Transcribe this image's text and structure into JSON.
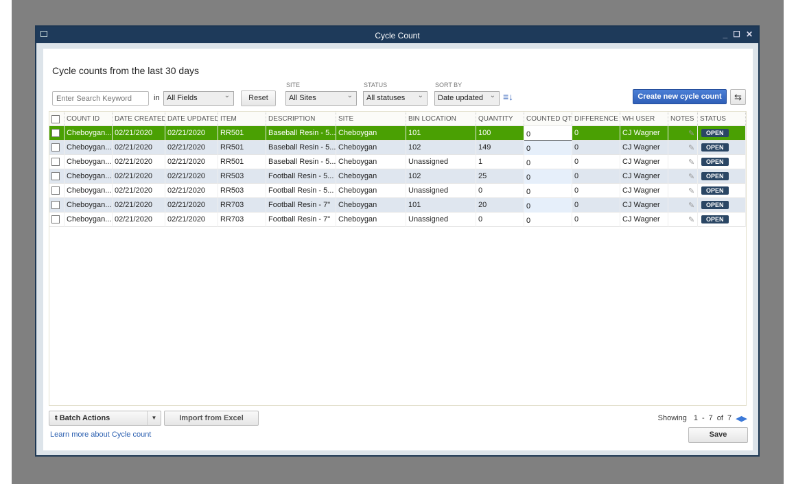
{
  "window": {
    "title": "Cycle Count"
  },
  "header": {
    "title": "Cycle counts from the last 30 days"
  },
  "filters": {
    "search_placeholder": "Enter Search Keyword",
    "in_label": "in",
    "field": "All Fields",
    "reset": "Reset",
    "site_label": "SITE",
    "site": "All Sites",
    "status_label": "STATUS",
    "status": "All statuses",
    "sort_label": "SORT BY",
    "sort": "Date updated",
    "create": "Create new cycle count"
  },
  "table": {
    "columns": [
      "COUNT ID",
      "DATE CREATED",
      "DATE UPDATED",
      "ITEM",
      "DESCRIPTION",
      "SITE",
      "BIN LOCATION",
      "QUANTITY",
      "COUNTED QTY",
      "DIFFERENCE",
      "WH USER",
      "NOTES",
      "STATUS"
    ],
    "rows": [
      [
        "Cheboygan...",
        "02/21/2020",
        "02/21/2020",
        "RR501",
        "Baseball Resin - 5...",
        "Cheboygan",
        "101",
        "100",
        "0",
        "0",
        "CJ Wagner",
        "",
        "OPEN"
      ],
      [
        "Cheboygan...",
        "02/21/2020",
        "02/21/2020",
        "RR501",
        "Baseball Resin - 5...",
        "Cheboygan",
        "102",
        "149",
        "0",
        "0",
        "CJ Wagner",
        "",
        "OPEN"
      ],
      [
        "Cheboygan...",
        "02/21/2020",
        "02/21/2020",
        "RR501",
        "Baseball Resin - 5...",
        "Cheboygan",
        "Unassigned",
        "1",
        "0",
        "0",
        "CJ Wagner",
        "",
        "OPEN"
      ],
      [
        "Cheboygan...",
        "02/21/2020",
        "02/21/2020",
        "RR503",
        "Football Resin - 5...",
        "Cheboygan",
        "102",
        "25",
        "0",
        "0",
        "CJ Wagner",
        "",
        "OPEN"
      ],
      [
        "Cheboygan...",
        "02/21/2020",
        "02/21/2020",
        "RR503",
        "Football Resin - 5...",
        "Cheboygan",
        "Unassigned",
        "0",
        "0",
        "0",
        "CJ Wagner",
        "",
        "OPEN"
      ],
      [
        "Cheboygan...",
        "02/21/2020",
        "02/21/2020",
        "RR703",
        "Football Resin - 7\"",
        "Cheboygan",
        "101",
        "20",
        "0",
        "0",
        "CJ Wagner",
        "",
        "OPEN"
      ],
      [
        "Cheboygan...",
        "02/21/2020",
        "02/21/2020",
        "RR703",
        "Football Resin - 7\"",
        "Cheboygan",
        "Unassigned",
        "0",
        "0",
        "0",
        "CJ Wagner",
        "",
        "OPEN"
      ]
    ]
  },
  "footer": {
    "batch": "Batch Actions",
    "import": "Import from Excel",
    "learn": "Learn more about Cycle count",
    "showing": "Showing",
    "from": "1",
    "dash": "-",
    "to": "7",
    "of": "of",
    "total": "7",
    "save": "Save"
  },
  "colors": {
    "selected_row": "#4aa003",
    "accent": "#2f5fb8",
    "title_bar": "#1e3a5a"
  }
}
